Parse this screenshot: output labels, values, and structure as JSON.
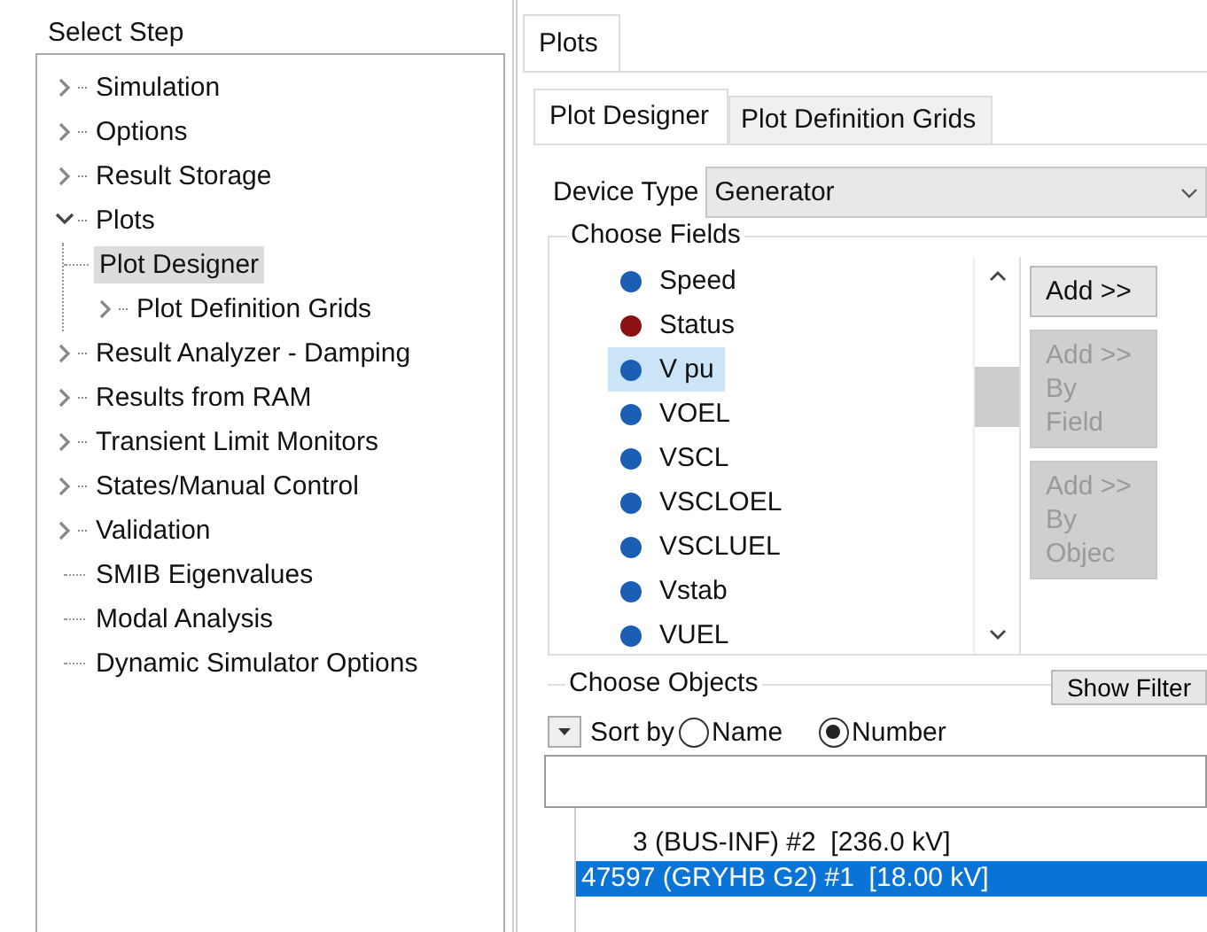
{
  "step_panel": {
    "title": "Select Step",
    "tree": [
      {
        "label": "Simulation",
        "kind": "branch",
        "expanded": false,
        "selected": false
      },
      {
        "label": "Options",
        "kind": "branch",
        "expanded": false,
        "selected": false
      },
      {
        "label": "Result Storage",
        "kind": "branch",
        "expanded": false,
        "selected": false
      },
      {
        "label": "Plots",
        "kind": "branch",
        "expanded": true,
        "selected": false,
        "children": [
          {
            "label": "Plot Designer",
            "kind": "leaf",
            "selected": true
          },
          {
            "label": "Plot Definition Grids",
            "kind": "branch",
            "expanded": false,
            "selected": false
          }
        ]
      },
      {
        "label": "Result Analyzer - Damping",
        "kind": "branch",
        "expanded": false,
        "selected": false
      },
      {
        "label": "Results from RAM",
        "kind": "branch",
        "expanded": false,
        "selected": false
      },
      {
        "label": "Transient Limit Monitors",
        "kind": "branch",
        "expanded": false,
        "selected": false
      },
      {
        "label": "States/Manual Control",
        "kind": "branch",
        "expanded": false,
        "selected": false
      },
      {
        "label": "Validation",
        "kind": "branch",
        "expanded": false,
        "selected": false
      },
      {
        "label": "SMIB Eigenvalues",
        "kind": "leaf",
        "selected": false
      },
      {
        "label": "Modal Analysis",
        "kind": "leaf",
        "selected": false
      },
      {
        "label": "Dynamic Simulator Options",
        "kind": "leaf",
        "selected": false
      }
    ]
  },
  "outer_tabs": [
    {
      "label": "Plots",
      "selected": true
    }
  ],
  "inner_tabs": [
    {
      "label": "Plot Designer",
      "selected": true
    },
    {
      "label": "Plot Definition Grids",
      "selected": false
    }
  ],
  "device_type": {
    "label": "Device Type",
    "value": "Generator"
  },
  "choose_fields": {
    "title": "Choose Fields",
    "fields": [
      {
        "label": "Speed",
        "color": "#1a5fb4",
        "selected": false
      },
      {
        "label": "Status",
        "color": "#8b1010",
        "selected": false
      },
      {
        "label": "V pu",
        "color": "#1a5fb4",
        "selected": true
      },
      {
        "label": "VOEL",
        "color": "#1a5fb4",
        "selected": false
      },
      {
        "label": "VSCL",
        "color": "#1a5fb4",
        "selected": false
      },
      {
        "label": "VSCLOEL",
        "color": "#1a5fb4",
        "selected": false
      },
      {
        "label": "VSCLUEL",
        "color": "#1a5fb4",
        "selected": false
      },
      {
        "label": "Vstab",
        "color": "#1a5fb4",
        "selected": false
      },
      {
        "label": "VUEL",
        "color": "#1a5fb4",
        "selected": false
      }
    ],
    "buttons": [
      {
        "lines": [
          "Add >>"
        ],
        "disabled": false
      },
      {
        "lines": [
          "Add >>",
          "By Field"
        ],
        "disabled": true
      },
      {
        "lines": [
          "Add >>",
          "By Objec"
        ],
        "disabled": true
      }
    ]
  },
  "choose_objects": {
    "title": "Choose Objects",
    "filter_button": "Show Filter",
    "sort_label": "Sort by",
    "sort_options": [
      {
        "label": "Name",
        "selected": false
      },
      {
        "label": "Number",
        "selected": true
      }
    ],
    "objects": [
      {
        "label": "3 (BUS-INF) #2  [236.0 kV]",
        "selected": false
      },
      {
        "label": "47597 (GRYHB G2) #1  [18.00 kV]",
        "selected": true
      }
    ]
  }
}
